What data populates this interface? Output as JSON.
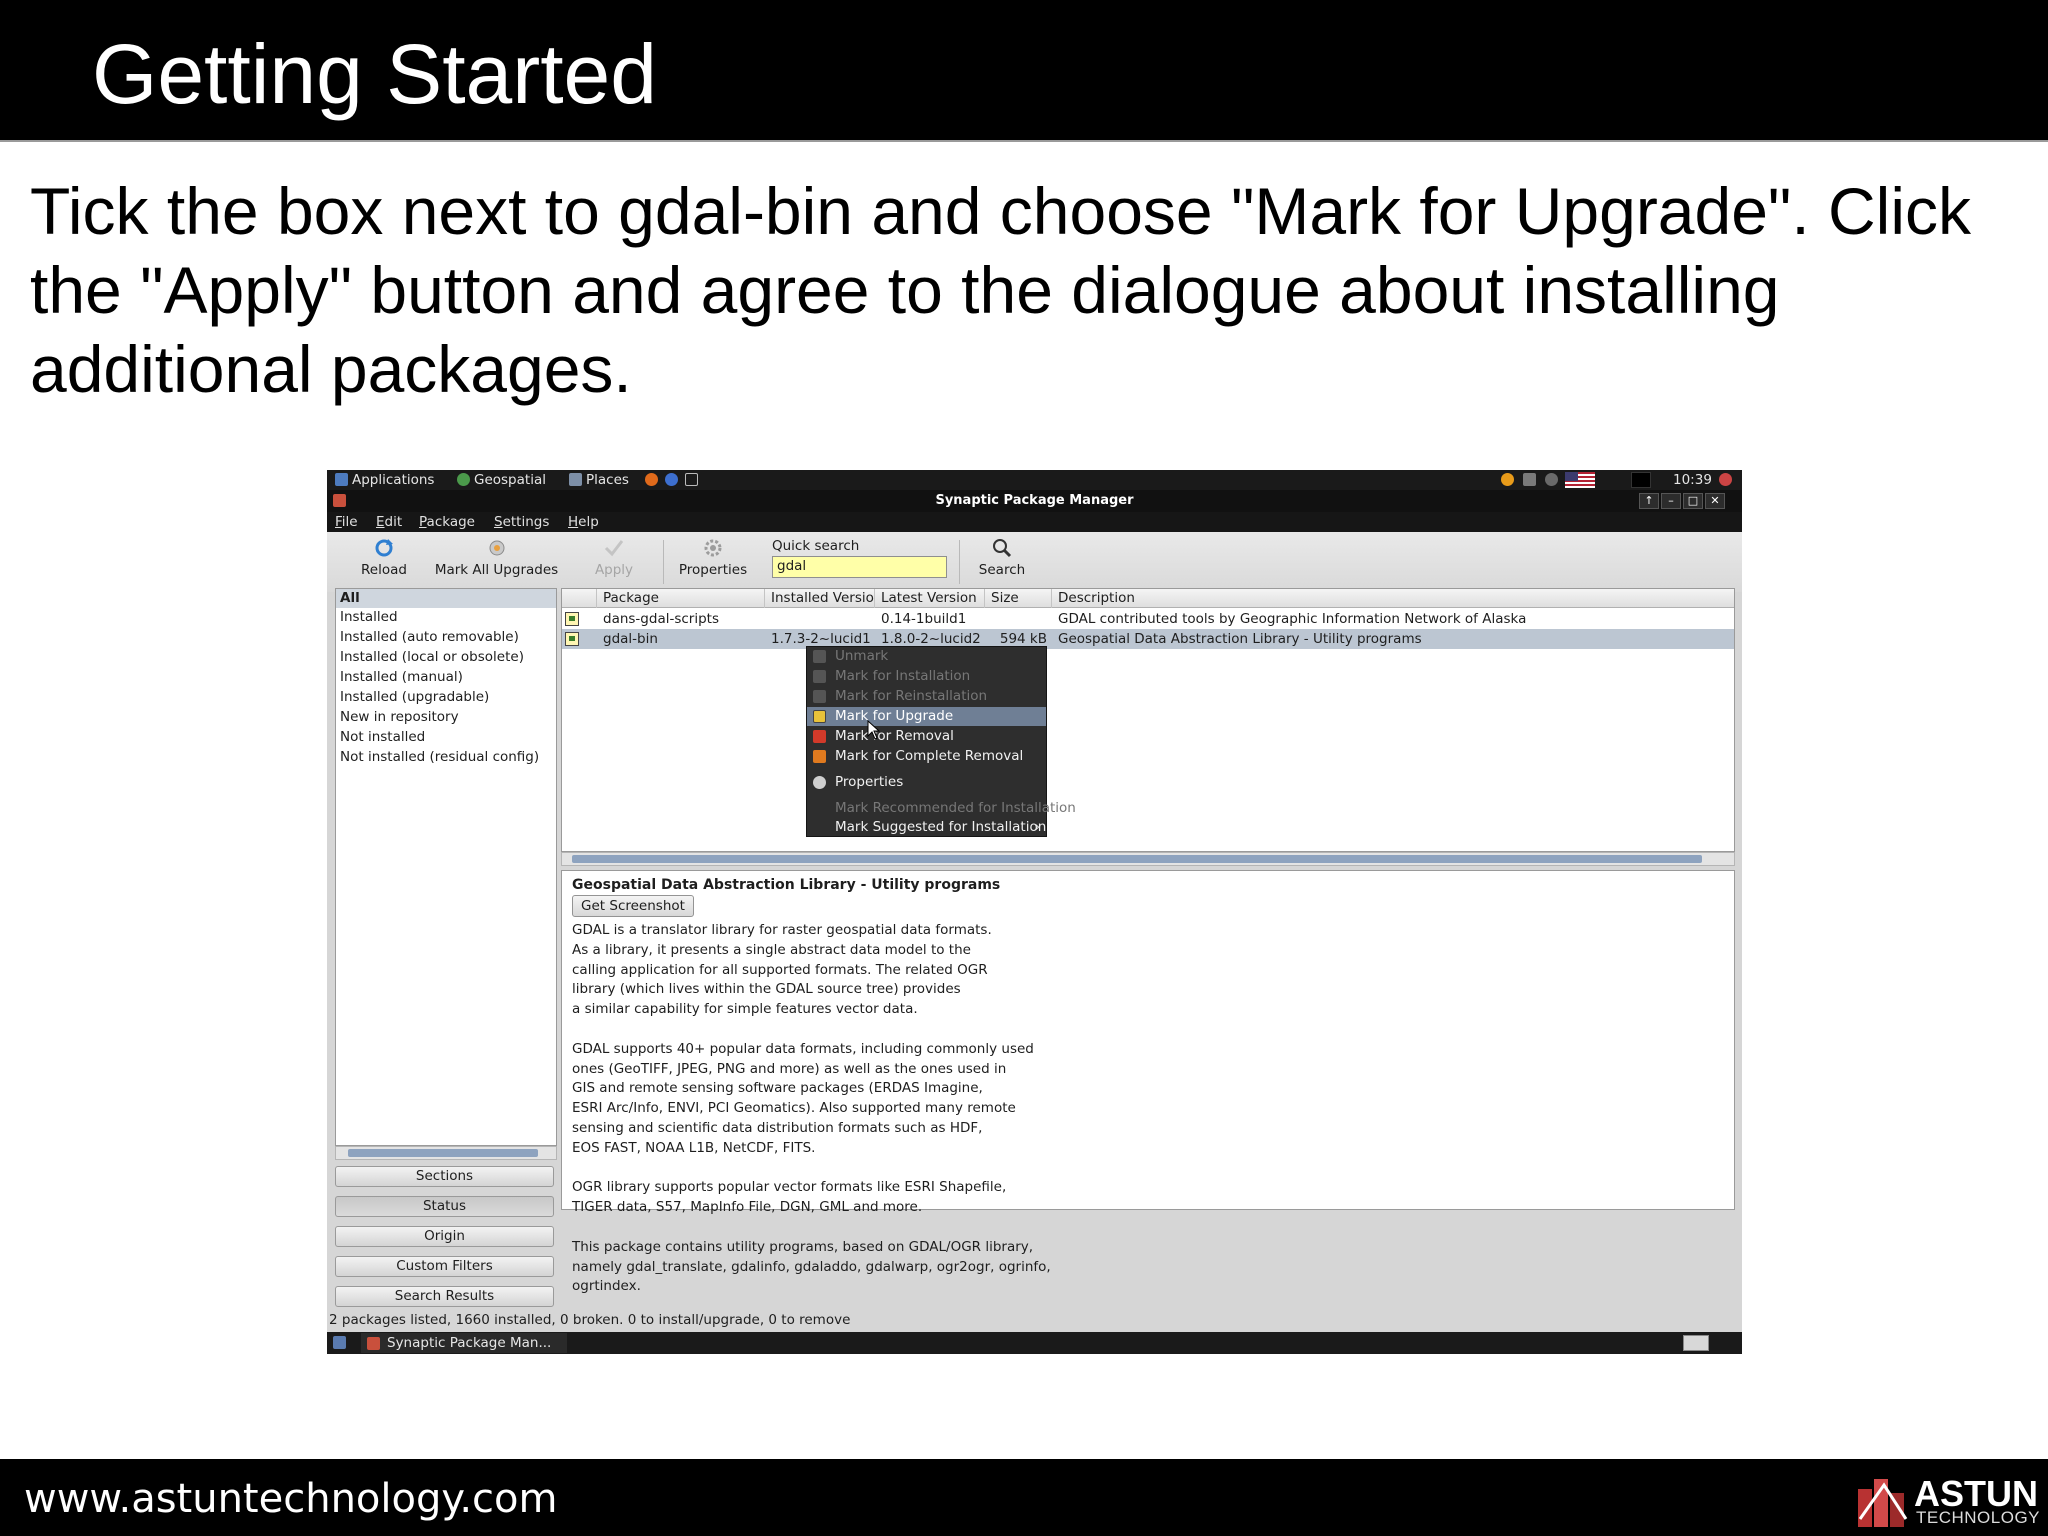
{
  "slide": {
    "title": "Getting Started",
    "body": "Tick the box next to gdal-bin and choose \"Mark for Upgrade\". Click the \"Apply\" button and agree to the dialogue about installing additional packages.",
    "footer_url": "www.astuntechnology.com",
    "logo": {
      "name": "ASTUN",
      "sub": "TECHNOLOGY"
    }
  },
  "top_panel": {
    "items": [
      "Applications",
      "Geospatial",
      "Places"
    ],
    "clock": "10:39"
  },
  "window": {
    "title": "Synaptic Package Manager",
    "menu": [
      "File",
      "Edit",
      "Package",
      "Settings",
      "Help"
    ]
  },
  "toolbar": {
    "reload": "Reload",
    "mark_all": "Mark All Upgrades",
    "apply": "Apply",
    "properties": "Properties",
    "quick_search_label": "Quick search",
    "quick_search_value": "gdal",
    "search": "Search"
  },
  "filters": {
    "items": [
      "All",
      "Installed",
      "Installed (auto removable)",
      "Installed (local or obsolete)",
      "Installed (manual)",
      "Installed (upgradable)",
      "New in repository",
      "Not installed",
      "Not installed (residual config)"
    ],
    "buttons": [
      "Sections",
      "Status",
      "Origin",
      "Custom Filters",
      "Search Results"
    ]
  },
  "table": {
    "columns": [
      "Package",
      "Installed Version",
      "Latest Version",
      "Size",
      "Description"
    ],
    "rows": [
      {
        "package": "dans-gdal-scripts",
        "installed": "",
        "latest": "0.14-1build1",
        "size": "",
        "description": "GDAL contributed tools by Geographic Information Network of Alaska"
      },
      {
        "package": "gdal-bin",
        "installed": "1.7.3-2~lucid1",
        "latest": "1.8.0-2~lucid2",
        "size": "594 kB",
        "description": "Geospatial Data Abstraction Library - Utility programs"
      }
    ]
  },
  "context_menu": {
    "items": [
      "Unmark",
      "Mark for Installation",
      "Mark for Reinstallation",
      "Mark for Upgrade",
      "Mark for Removal",
      "Mark for Complete Removal",
      "Properties",
      "Mark Recommended for Installation",
      "Mark Suggested for Installation"
    ]
  },
  "details": {
    "title": "Geospatial Data Abstraction Library - Utility programs",
    "screenshot_button": "Get Screenshot",
    "text": "GDAL is a translator library for raster geospatial data formats.\nAs a library, it presents a single abstract data model to the\ncalling application for all supported formats. The related OGR\nlibrary (which lives within the GDAL source tree) provides\na similar capability for simple features vector data.\n\nGDAL supports 40+ popular data formats, including commonly used\nones (GeoTIFF, JPEG, PNG and more) as well as the ones used in\nGIS and remote sensing software packages (ERDAS Imagine,\nESRI Arc/Info, ENVI, PCI Geomatics). Also supported many remote\nsensing and scientific data distribution formats such as HDF,\nEOS FAST, NOAA L1B, NetCDF, FITS.\n\nOGR library supports popular vector formats like ESRI Shapefile,\nTIGER data, S57, MapInfo File, DGN, GML and more.\n\nThis package contains utility programs, based on GDAL/OGR library,\nnamely gdal_translate, gdalinfo, gdaladdo, gdalwarp, ogr2ogr, ogrinfo,\nogrtindex."
  },
  "statusbar": "2 packages listed, 1660 installed, 0 broken. 0 to install/upgrade, 0 to remove",
  "taskbar": {
    "window": "Synaptic Package Man..."
  }
}
